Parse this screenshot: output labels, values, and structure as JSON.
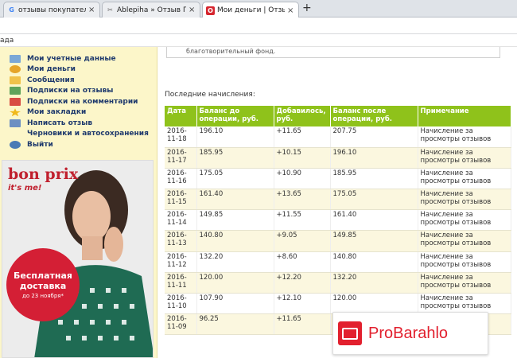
{
  "browser": {
    "tabs": [
      {
        "title": "отзывы покупателей - По",
        "favicon": "G",
        "favicon_color": "#4285f4",
        "active": false
      },
      {
        "title": "Ablepiha » Отзыв ПРО - р",
        "favicon": "✂",
        "favicon_color": "#6a6a6a",
        "active": false
      },
      {
        "title": "Мои деньги | Отзывы пос",
        "favicon": "O",
        "favicon_color": "#d6262f",
        "active": true
      }
    ],
    "close_glyph": "×",
    "new_tab_glyph": "+",
    "bookmark_fragment": "ада"
  },
  "sidebar": {
    "menu": [
      {
        "label": "Мои учетные данные",
        "icon": "id-card-icon",
        "color": "#7aa7d6"
      },
      {
        "label": "Мои деньги",
        "icon": "coins-icon",
        "color": "#e5a52a"
      },
      {
        "label": "Сообщения",
        "icon": "envelope-icon",
        "color": "#f0c24a"
      },
      {
        "label": "Подписки на отзывы",
        "icon": "subscribe-icon",
        "color": "#5fa35a"
      },
      {
        "label": "Подписки на комментарии",
        "icon": "comment-icon",
        "color": "#d84c43"
      },
      {
        "label": "Мои закладки",
        "icon": "star-icon",
        "color": "#f1b91b"
      },
      {
        "label": "Написать отзыв",
        "icon": "pencil-icon",
        "color": "#6c8fc2"
      },
      {
        "label": "Черновики и автосохранения",
        "icon": "draft-icon",
        "color": "#c7c7c7"
      },
      {
        "label": "Выйти",
        "icon": "exit-icon",
        "color": "#4a7bb5"
      }
    ]
  },
  "ad": {
    "logo_text": "bon prix",
    "logo_tagline": "it's me!",
    "promo_line1": "Бесплатная",
    "promo_line2": "доставка",
    "promo_line3": "до 23 ноября*"
  },
  "main": {
    "prev_box_text": "благотворительный фонд.",
    "section_title": "Последние начисления:",
    "table": {
      "headers": [
        "Дата",
        "Баланс до операции, руб.",
        "Добавилось, руб.",
        "Баланс после операции, руб.",
        "Примечание"
      ],
      "rows": [
        [
          "2016-11-18",
          "196.10",
          "+11.65",
          "207.75",
          "Начисление за просмотры отзывов"
        ],
        [
          "2016-11-17",
          "185.95",
          "+10.15",
          "196.10",
          "Начисление за просмотры отзывов"
        ],
        [
          "2016-11-16",
          "175.05",
          "+10.90",
          "185.95",
          "Начисление за просмотры отзывов"
        ],
        [
          "2016-11-15",
          "161.40",
          "+13.65",
          "175.05",
          "Начисление за просмотры отзывов"
        ],
        [
          "2016-11-14",
          "149.85",
          "+11.55",
          "161.40",
          "Начисление за просмотры отзывов"
        ],
        [
          "2016-11-13",
          "140.80",
          "+9.05",
          "149.85",
          "Начисление за просмотры отзывов"
        ],
        [
          "2016-11-12",
          "132.20",
          "+8.60",
          "140.80",
          "Начисление за просмотры отзывов"
        ],
        [
          "2016-11-11",
          "120.00",
          "+12.20",
          "132.20",
          "Начисление за просмотры отзывов"
        ],
        [
          "2016-11-10",
          "107.90",
          "+12.10",
          "120.00",
          "Начисление за просмотры отзывов"
        ],
        [
          "2016-11-09",
          "96.25",
          "+11.65",
          "",
          ""
        ]
      ]
    }
  },
  "watermark": {
    "text": "ProBarahlo",
    "icon": "radio-icon"
  },
  "colors": {
    "header_green": "#8fc21b",
    "sidebar_bg": "#fcf6c9",
    "link": "#1f3a6d",
    "brand_red": "#e2202e"
  }
}
